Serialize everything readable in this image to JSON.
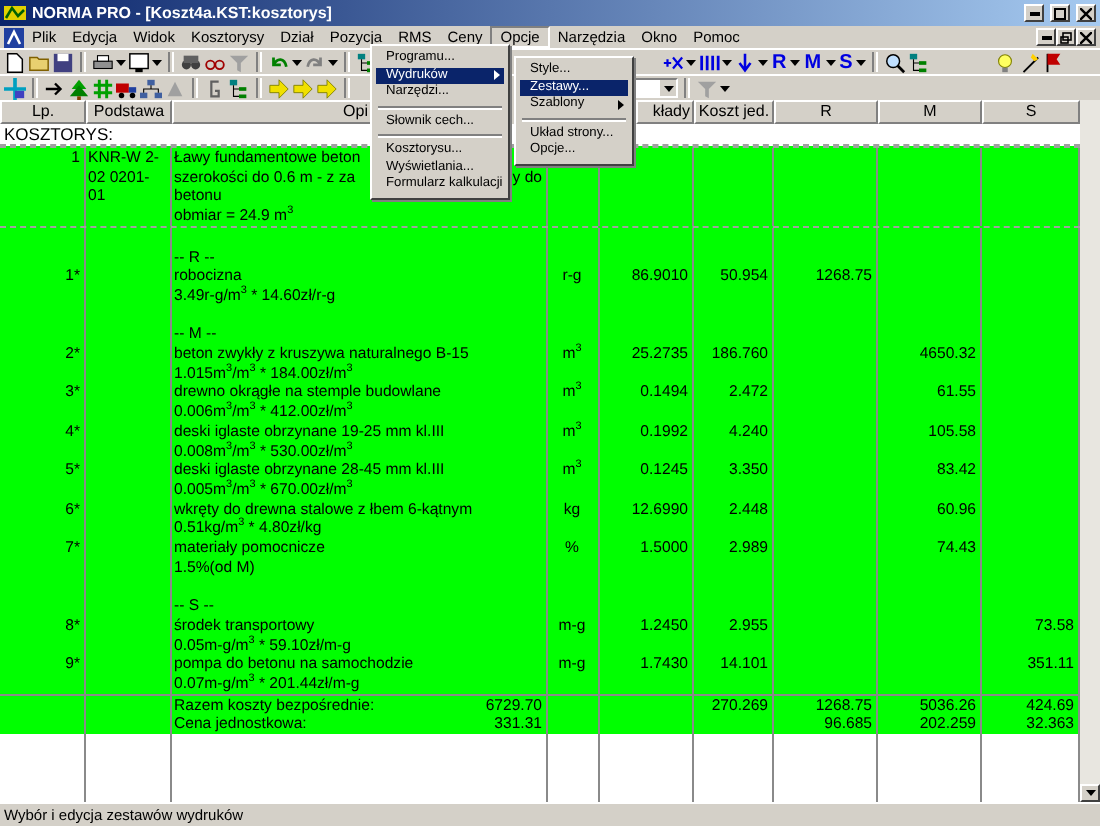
{
  "window": {
    "title": "NORMA PRO - [Koszt4a.KST:kosztorys]"
  },
  "menu_bar": [
    {
      "label": "Plik",
      "selected": false
    },
    {
      "label": "Edycja",
      "selected": false
    },
    {
      "label": "Widok",
      "selected": false
    },
    {
      "label": "Kosztorysy",
      "selected": false
    },
    {
      "label": "Dział",
      "selected": false
    },
    {
      "label": "Pozycja",
      "selected": false
    },
    {
      "label": "RMS",
      "selected": false
    },
    {
      "label": "Ceny",
      "selected": false
    },
    {
      "label": "Opcje",
      "selected": true
    },
    {
      "label": "Narzędzia",
      "selected": false
    },
    {
      "label": "Okno",
      "selected": false
    },
    {
      "label": "Pomoc",
      "selected": false
    }
  ],
  "options_menu": [
    {
      "kind": "item",
      "label": "Programu...",
      "selected": false
    },
    {
      "kind": "submenu",
      "label": "Wydruków",
      "selected": true
    },
    {
      "kind": "item",
      "label": "Narzędzi...",
      "selected": false
    },
    {
      "kind": "separator"
    },
    {
      "kind": "item",
      "label": "Słownik cech...",
      "selected": false
    },
    {
      "kind": "separator"
    },
    {
      "kind": "item",
      "label": "Kosztorysu...",
      "selected": false
    },
    {
      "kind": "item",
      "label": "Wyświetlania...",
      "selected": false
    },
    {
      "kind": "item",
      "label": "Formularz kalkulacji",
      "selected": false
    }
  ],
  "printouts_submenu": [
    {
      "kind": "item",
      "label": "Style...",
      "selected": false
    },
    {
      "kind": "item",
      "label": "Zestawy...",
      "selected": true
    },
    {
      "kind": "submenu",
      "label": "Szablony",
      "selected": false
    },
    {
      "kind": "separator"
    },
    {
      "kind": "item",
      "label": "Układ strony...",
      "selected": false
    },
    {
      "kind": "item",
      "label": "Opcje...",
      "selected": false
    }
  ],
  "toolbar_letters": [
    "R",
    "M",
    "S"
  ],
  "table": {
    "columns": [
      "Lp.",
      "Podstawa",
      "Opi",
      "kłady",
      "Koszt jed.",
      "R",
      "M",
      "S"
    ],
    "caption": "KOSZTORYS:",
    "rows": [
      {
        "kind": "position",
        "lp": "1",
        "basis": [
          "KNR-W 2-",
          "02 0201-",
          "01"
        ],
        "lines": [
          {
            "text": "Ławy fundamentowe beton"
          },
          {
            "text": "szerokości do 0.6 m - z za",
            "tail": "y do"
          },
          {
            "text": "betonu"
          },
          {
            "text": "obmiar  = 24.9 m$^{3}$"
          }
        ]
      },
      {
        "kind": "section",
        "text": "-- R --"
      },
      {
        "kind": "resource",
        "lp": "1*",
        "name": "robocizna",
        "formula": "3.49r-g/m$^{3}$ * 14.60zł/r-g",
        "unit": "r-g",
        "quantity": "86.9010",
        "price": "50.954",
        "r": "1268.75"
      },
      {
        "kind": "section",
        "text": "-- M --"
      },
      {
        "kind": "resource",
        "lp": "2*",
        "name": "beton zwykły z kruszywa naturalnego B-15",
        "formula": "1.015m$^{3}$/m$^{3}$ * 184.00zł/m$^{3}$",
        "unit": "m$^{3}$",
        "quantity": "25.2735",
        "price": "186.760",
        "m": "4650.32"
      },
      {
        "kind": "resource",
        "lp": "3*",
        "name": "drewno okrągłe na stemple budowlane",
        "formula": "0.006m$^{3}$/m$^{3}$ * 412.00zł/m$^{3}$",
        "unit": "m$^{3}$",
        "quantity": "0.1494",
        "price": "2.472",
        "m": "61.55"
      },
      {
        "kind": "resource",
        "lp": "4*",
        "name": "deski iglaste obrzynane 19-25 mm kl.III",
        "formula": "0.008m$^{3}$/m$^{3}$ * 530.00zł/m$^{3}$",
        "unit": "m$^{3}$",
        "quantity": "0.1992",
        "price": "4.240",
        "m": "105.58"
      },
      {
        "kind": "resource",
        "lp": "5*",
        "name": "deski iglaste obrzynane 28-45 mm kl.III",
        "formula": "0.005m$^{3}$/m$^{3}$ * 670.00zł/m$^{3}$",
        "unit": "m$^{3}$",
        "quantity": "0.1245",
        "price": "3.350",
        "m": "83.42"
      },
      {
        "kind": "resource",
        "lp": "6*",
        "name": "wkręty do drewna stalowe z łbem 6-kątnym",
        "formula": "0.51kg/m$^{3}$ * 4.80zł/kg",
        "unit": "kg",
        "quantity": "12.6990",
        "price": "2.448",
        "m": "60.96"
      },
      {
        "kind": "resource",
        "lp": "7*",
        "name": "materiały pomocnicze",
        "formula": "1.5%(od M)",
        "unit": "%",
        "quantity": "1.5000",
        "price": "2.989",
        "m": "74.43"
      },
      {
        "kind": "section",
        "text": "-- S --"
      },
      {
        "kind": "resource",
        "lp": "8*",
        "name": "środek transportowy",
        "formula": "0.05m-g/m$^{3}$ * 59.10zł/m-g",
        "unit": "m-g",
        "quantity": "1.2450",
        "price": "2.955",
        "s": "73.58"
      },
      {
        "kind": "resource",
        "lp": "9*",
        "name": "pompa do betonu na samochodzie",
        "formula": "0.07m-g/m$^{3}$ * 201.44zł/m-g",
        "unit": "m-g",
        "quantity": "1.7430",
        "price": "14.101",
        "s": "351.11"
      }
    ],
    "totals": [
      {
        "label": "Razem koszty bezpośrednie:",
        "value": "6729.70",
        "price": "270.269",
        "r": "1268.75",
        "m": "5036.26",
        "s": "424.69"
      },
      {
        "label": "Cena jednostkowa:",
        "value": "331.31",
        "r": "96.685",
        "m": "202.259",
        "s": "32.363"
      }
    ]
  },
  "status_bar": "Wybór i edycja zestawów wydruków"
}
